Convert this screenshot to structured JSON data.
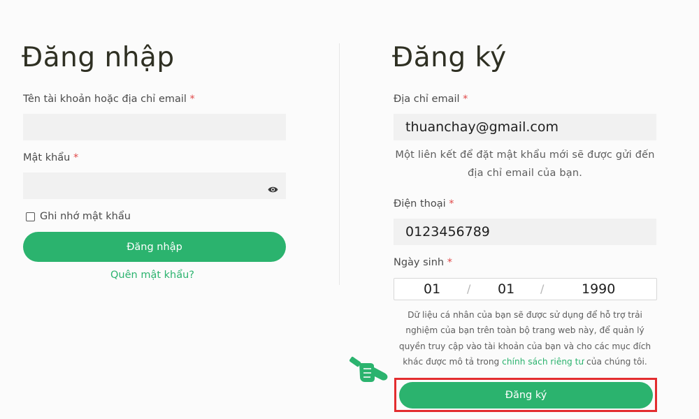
{
  "login": {
    "title": "Đăng nhập",
    "username_label": "Tên tài khoản hoặc địa chỉ email",
    "password_label": "Mật khẩu",
    "required_mark": "*",
    "username_value": "",
    "password_value": "",
    "remember_label": "Ghi nhớ mật khẩu",
    "remember_checked": false,
    "submit_label": "Đăng nhập",
    "forgot_label": "Quên mật khẩu?"
  },
  "register": {
    "title": "Đăng ký",
    "email_label": "Địa chỉ email",
    "email_value": "thuanchay@gmail.com",
    "email_hint_line1": "Một liên kết để đặt mật khẩu mới sẽ được gửi đến",
    "email_hint_line2": "địa chỉ email của bạn.",
    "phone_label": "Điện thoại",
    "phone_value": "0123456789",
    "birthday_label": "Ngày sinh",
    "birthday_day": "01",
    "birthday_month": "01",
    "birthday_year": "1990",
    "date_separator": "/",
    "privacy_line1": "Dữ liệu cá nhân của bạn sẽ được sử dụng để hỗ trợ trải",
    "privacy_line2": "nghiệm của bạn trên toàn bộ trang web này, để quản lý",
    "privacy_line3": "quyền truy cập vào tài khoản của bạn và cho các mục đích",
    "privacy_line4_pre": "khác được mô tả trong",
    "privacy_link": "chính sách riêng tư",
    "privacy_line4_post": "của chúng tôi.",
    "submit_label": "Đăng ký"
  },
  "icons": {
    "password_toggle": "eye-icon",
    "pointer": "pointing-hand-icon"
  },
  "colors": {
    "accent": "#2bb36e",
    "required": "#e04848",
    "highlight_frame": "#e32d2f",
    "title": "#2f3023",
    "input_bg": "#f1f1f1"
  }
}
